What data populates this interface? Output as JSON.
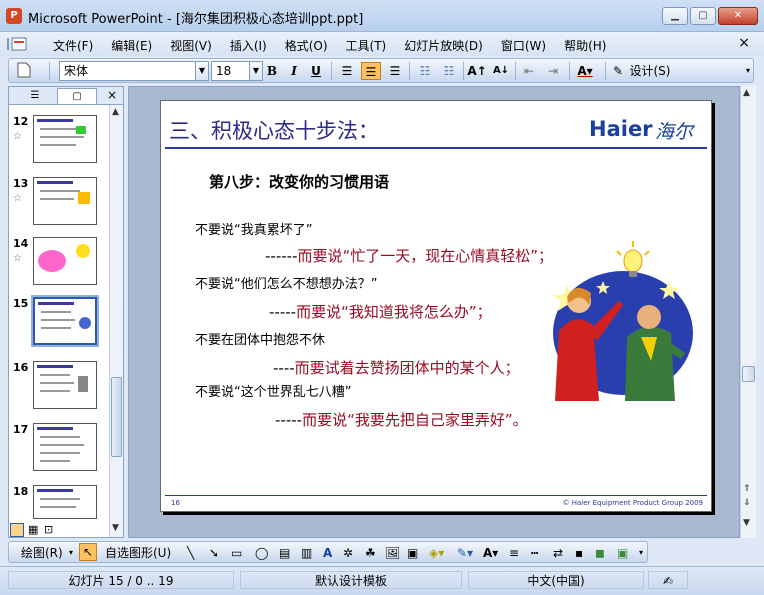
{
  "window": {
    "app_icon": "P",
    "title": "Microsoft PowerPoint - [海尔集团积极心态培训ppt.ppt]",
    "min_icon": "minimize-icon",
    "max_icon": "maximize-icon",
    "close_icon": "close-icon"
  },
  "menu": {
    "items": [
      "文件(F)",
      "编辑(E)",
      "视图(V)",
      "插入(I)",
      "格式(O)",
      "工具(T)",
      "幻灯片放映(D)",
      "窗口(W)",
      "帮助(H)"
    ],
    "close_glyph": "×"
  },
  "toolbar": {
    "font_name": "宋体",
    "font_size": "18",
    "bold": "B",
    "italic": "I",
    "underline": "U",
    "design_label": "设计(S)"
  },
  "slide_panel": {
    "thumbnails": [
      {
        "num": "12",
        "star": "☆"
      },
      {
        "num": "13",
        "star": "☆"
      },
      {
        "num": "14",
        "star": "☆"
      },
      {
        "num": "15",
        "star": ""
      },
      {
        "num": "16",
        "star": ""
      },
      {
        "num": "17",
        "star": ""
      },
      {
        "num": "18",
        "star": ""
      }
    ],
    "close_glyph": "×"
  },
  "slide": {
    "title": "三、积极心态十步法：",
    "brand": "Haier",
    "brand_cn": "海尔",
    "step": "第八步：改变你的习惯用语",
    "lines": [
      {
        "type": "black",
        "text": "不要说“我真累坏了”"
      },
      {
        "type": "red",
        "dash": "------",
        "text": "而要说“忙了一天，现在心情真轻松”；"
      },
      {
        "type": "black",
        "text": "不要说“他们怎么不想想办法？”"
      },
      {
        "type": "red",
        "dash": "-----",
        "text": "而要说“我知道我将怎么办”；"
      },
      {
        "type": "black",
        "text": "不要在团体中抱怨不休"
      },
      {
        "type": "red",
        "dash": "----",
        "text": "而要试着去赞扬团体中的某个人；"
      },
      {
        "type": "black",
        "text": "不要说“这个世界乱七八糟”"
      },
      {
        "type": "red",
        "dash": "-----",
        "text": "而要说“我要先把自己家里弄好”。"
      }
    ],
    "page_number": "16",
    "copyright": "© Haier Equipment Product Group 2009"
  },
  "draw_toolbar": {
    "draw_label": "绘图(R)",
    "autoshape_label": "自选图形(U)"
  },
  "status": {
    "slide_info": "幻灯片 15 / 0 .. 19",
    "template": "默认设计模板",
    "language": "中文(中国)"
  },
  "colors": {
    "title_blue": "#2a2a8a",
    "brand_blue": "#1a3f9c",
    "emphasis_red": "#9b0a22"
  }
}
